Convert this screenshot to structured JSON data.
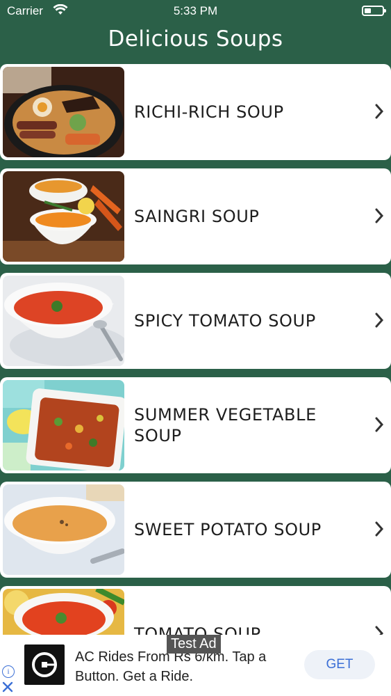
{
  "status_bar": {
    "carrier": "Carrier",
    "time": "5:33 PM"
  },
  "nav": {
    "title": "Delicious Soups"
  },
  "soups": [
    {
      "label": "RICHI-RICH SOUP",
      "image": "ramen-bowl-photo"
    },
    {
      "label": "SAINGRI SOUP",
      "image": "carrot-soup-cups-photo"
    },
    {
      "label": "SPICY TOMATO SOUP",
      "image": "tomato-soup-bowl-photo"
    },
    {
      "label": "SUMMER VEGETABLE SOUP",
      "image": "vegetable-soup-dish-photo"
    },
    {
      "label": "SWEET POTATO SOUP",
      "image": "sweet-potato-soup-bowl-photo"
    },
    {
      "label": "TOMATO SOUP",
      "image": "tomato-soup-photo"
    }
  ],
  "ad": {
    "tag": "Test Ad",
    "text": "AC Rides From Rs 6/km. Tap a Button. Get a Ride.",
    "button": "GET",
    "info_icon": "info-icon",
    "close_icon": "close-icon"
  },
  "colors": {
    "theme_green": "#2b6048",
    "ad_link_blue": "#3b6fd6"
  }
}
